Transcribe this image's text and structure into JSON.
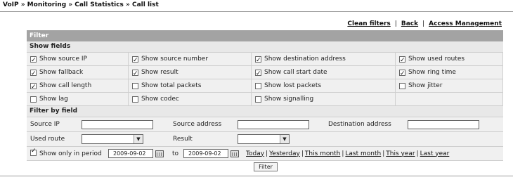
{
  "breadcrumb": "VoIP » Monitoring » Call Statistics » Call list",
  "top_links": [
    "Clean filters",
    "Back",
    "Access Management"
  ],
  "panel": {
    "title": "Filter",
    "show_fields_label": "Show fields",
    "filter_by_field_label": "Filter by field"
  },
  "show_fields": [
    {
      "label": "Show source IP",
      "checked": true
    },
    {
      "label": "Show source number",
      "checked": true
    },
    {
      "label": "Show destination address",
      "checked": true
    },
    {
      "label": "Show used routes",
      "checked": true
    },
    {
      "label": "Show fallback",
      "checked": true
    },
    {
      "label": "Show result",
      "checked": true
    },
    {
      "label": "Show call start date",
      "checked": true
    },
    {
      "label": "Show ring time",
      "checked": true
    },
    {
      "label": "Show call length",
      "checked": true
    },
    {
      "label": "Show total packets",
      "checked": false
    },
    {
      "label": "Show lost packets",
      "checked": false
    },
    {
      "label": "Show jitter",
      "checked": false
    },
    {
      "label": "Show lag",
      "checked": false
    },
    {
      "label": "Show codec",
      "checked": false
    },
    {
      "label": "Show signalling",
      "checked": false
    }
  ],
  "filters": {
    "source_ip_label": "Source IP",
    "source_ip_value": "",
    "source_address_label": "Source address",
    "source_address_value": "",
    "destination_address_label": "Destination address",
    "destination_address_value": "",
    "used_route_label": "Used route",
    "used_route_value": "",
    "result_label": "Result",
    "result_value": ""
  },
  "period": {
    "label": "Show only in period",
    "checked": true,
    "from": "2009-09-02",
    "to_label": "to",
    "to": "2009-09-02",
    "quick_links": [
      "Today",
      "Yesterday",
      "This month",
      "Last month",
      "This year",
      "Last year"
    ]
  },
  "filter_button": "Filter"
}
